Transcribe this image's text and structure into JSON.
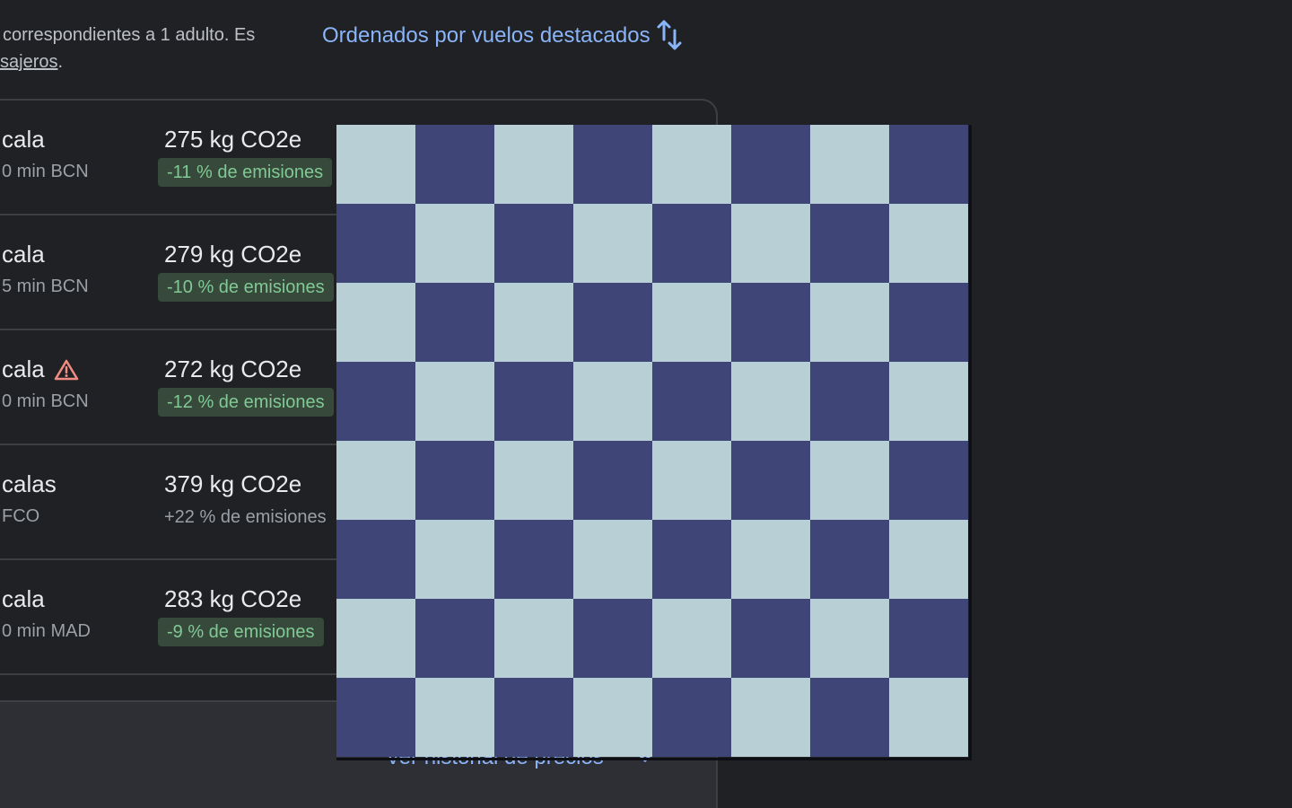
{
  "info": {
    "line1": "correspondientes a 1 adulto. Es",
    "line2_link": "sajeros",
    "line2_tail": "."
  },
  "sort": {
    "label": "Ordenados por vuelos destacados",
    "icon": "swap-vertical-icon"
  },
  "flights": [
    {
      "stops": "cala",
      "layover": "0 min BCN",
      "co2": "275 kg CO2e",
      "emissions": "-11 % de emisiones",
      "emissions_highlight": true,
      "warning": false
    },
    {
      "stops": "cala",
      "layover": "5 min BCN",
      "co2": "279 kg CO2e",
      "emissions": "-10 % de emisiones",
      "emissions_highlight": true,
      "warning": false
    },
    {
      "stops": "cala",
      "layover": "0 min BCN",
      "co2": "272 kg CO2e",
      "emissions": "-12 % de emisiones",
      "emissions_highlight": true,
      "warning": true
    },
    {
      "stops": "calas",
      "layover": "FCO",
      "co2": "379 kg CO2e",
      "emissions": "+22 % de emisiones",
      "emissions_highlight": false,
      "warning": false
    },
    {
      "stops": "cala",
      "layover": "0 min MAD",
      "co2": "283 kg CO2e",
      "emissions": "-9 % de emisiones",
      "emissions_highlight": true,
      "warning": false
    }
  ],
  "footer": {
    "history_label": "Ver historial de precios",
    "icon": "chevron-down-icon"
  },
  "overlay": {
    "light_color": "#b8cfd6",
    "dark_color": "#3f4677",
    "rows": 8,
    "cols": 8
  }
}
